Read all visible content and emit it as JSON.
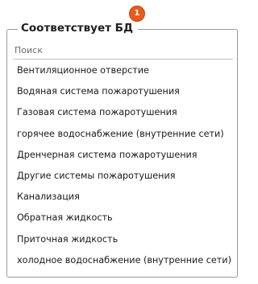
{
  "group": {
    "title": "Соответствует БД",
    "badge": "1"
  },
  "search": {
    "placeholder": "Поиск"
  },
  "items": [
    "Вентиляционное отверстие",
    "Водяная система пожаротушения",
    "Газовая система пожаротушения",
    "горячее водоснабжение (внутренние сети)",
    "Дренчерная система пожаротушения",
    "Другие системы пожаротушения",
    "Канализация",
    "Обратная жидкость",
    "Приточная жидкость",
    "холодное водоснабжение (внутренние сети)"
  ],
  "colors": {
    "badge": "#e85a1d"
  }
}
